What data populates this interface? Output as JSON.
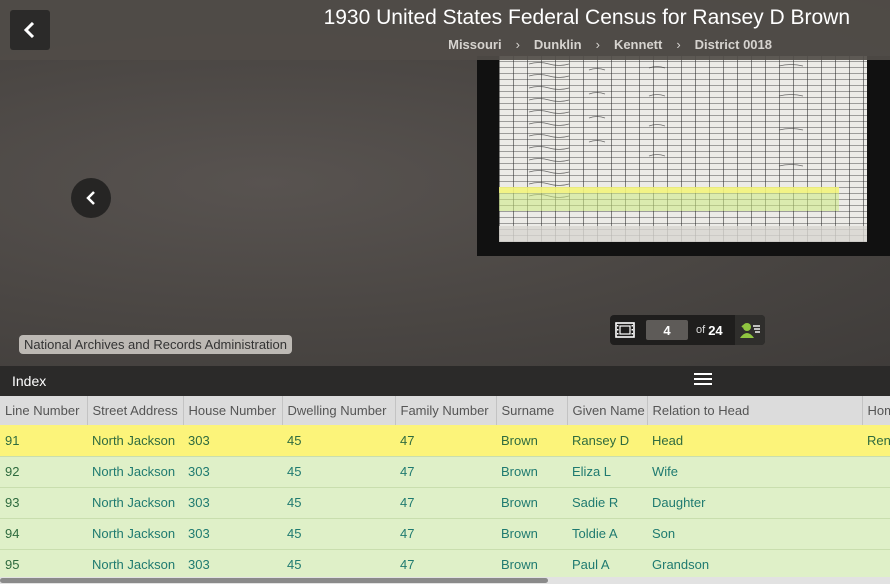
{
  "header": {
    "title": "1930 United States Federal Census for Ransey D Brown",
    "breadcrumbs": [
      "Missouri",
      "Dunklin",
      "Kennett",
      "District 0018"
    ],
    "separator": "›"
  },
  "viewer": {
    "source_label": "National Archives and Records Administration",
    "current_page": "4",
    "of_label": "of",
    "total_pages": "24"
  },
  "index": {
    "label": "Index",
    "columns": [
      "Line Number",
      "Street Address",
      "House Number",
      "Dwelling Number",
      "Family Number",
      "Surname",
      "Given Name",
      "Relation to Head",
      "Hom"
    ],
    "rows": [
      {
        "line": "91",
        "street": "North Jackson",
        "house": "303",
        "dwelling": "45",
        "family": "47",
        "surname": "Brown",
        "given": "Ransey D",
        "relation": "Head",
        "home": "Ren"
      },
      {
        "line": "92",
        "street": "North Jackson",
        "house": "303",
        "dwelling": "45",
        "family": "47",
        "surname": "Brown",
        "given": "Eliza L",
        "relation": "Wife",
        "home": ""
      },
      {
        "line": "93",
        "street": "North Jackson",
        "house": "303",
        "dwelling": "45",
        "family": "47",
        "surname": "Brown",
        "given": "Sadie R",
        "relation": "Daughter",
        "home": ""
      },
      {
        "line": "94",
        "street": "North Jackson",
        "house": "303",
        "dwelling": "45",
        "family": "47",
        "surname": "Brown",
        "given": "Toldie A",
        "relation": "Son",
        "home": ""
      },
      {
        "line": "95",
        "street": "North Jackson",
        "house": "303",
        "dwelling": "45",
        "family": "47",
        "surname": "Brown",
        "given": "Paul A",
        "relation": "Grandson",
        "home": ""
      }
    ]
  },
  "colors": {
    "active_row": "#fcf47a",
    "row": "#dff0c8",
    "link_text": "#1f7a70"
  },
  "icons": {
    "back": "chevron-left-icon",
    "prev": "chevron-left-icon",
    "film": "filmstrip-icon",
    "attach": "attach-person-icon",
    "menu": "hamburger-menu-icon"
  }
}
